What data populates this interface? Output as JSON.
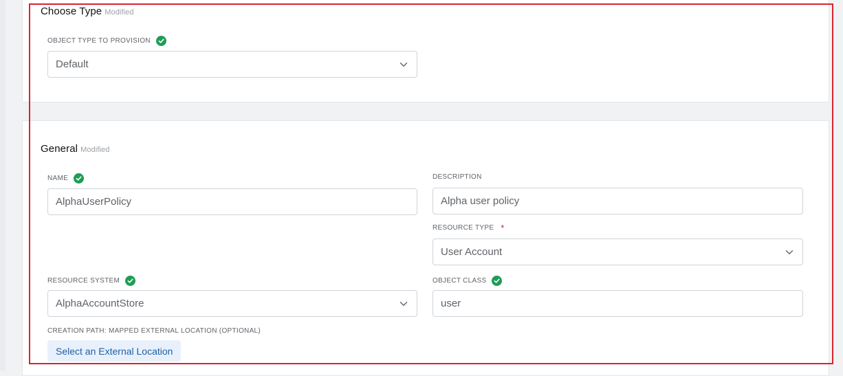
{
  "choose_type": {
    "title": "Choose Type",
    "modified": "Modified",
    "object_type_label": "OBJECT TYPE TO PROVISION",
    "object_type_value": "Default"
  },
  "general": {
    "title": "General",
    "modified": "Modified",
    "name_label": "NAME",
    "name_value": "AlphaUserPolicy",
    "description_label": "DESCRIPTION",
    "description_value": "Alpha user policy",
    "resource_type_label": "RESOURCE TYPE",
    "required_mark": "*",
    "resource_type_value": "User Account",
    "resource_system_label": "RESOURCE SYSTEM",
    "resource_system_value": "AlphaAccountStore",
    "object_class_label": "OBJECT CLASS",
    "object_class_value": "user",
    "creation_path_label": "CREATION PATH: MAPPED EXTERNAL LOCATION (OPTIONAL)",
    "select_location_button": "Select an External Location"
  },
  "icons": {
    "valid": "check-circle-icon",
    "dropdown": "chevron-down-icon"
  },
  "colors": {
    "valid_green": "#1f9d55",
    "required_red": "#c2255c",
    "highlight_red": "#d9232e",
    "button_bg": "#e8f1fb",
    "button_text": "#1f5fa8"
  }
}
